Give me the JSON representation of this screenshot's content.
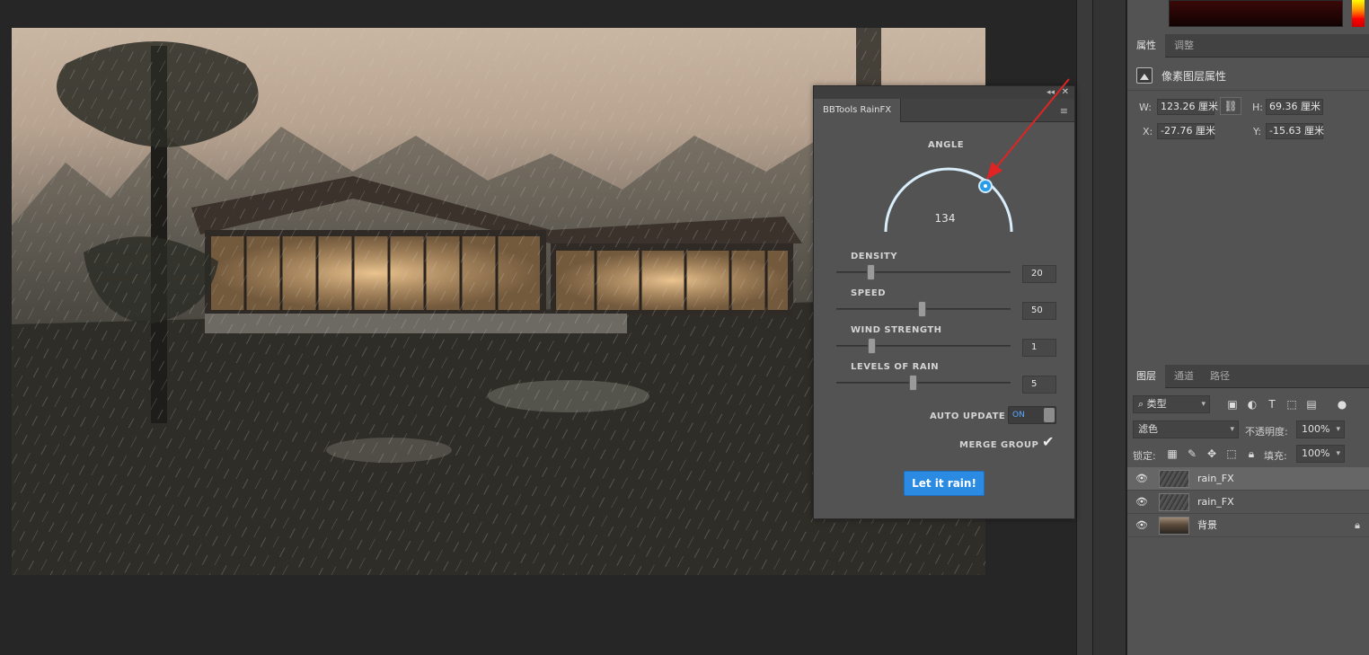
{
  "properties": {
    "tabs": [
      "属性",
      "调整"
    ],
    "title": "像素图层属性",
    "w_label": "W:",
    "w_value": "123.26 厘米",
    "h_label": "H:",
    "h_value": "69.36 厘米",
    "x_label": "X:",
    "x_value": "-27.76 厘米",
    "y_label": "Y:",
    "y_value": "-15.63 厘米"
  },
  "layers_panel": {
    "tabs": [
      "图层",
      "通道",
      "路径"
    ],
    "filter_kind": "类型",
    "blend_mode": "滤色",
    "opacity_label": "不透明度:",
    "opacity_value": "100%",
    "lock_label": "锁定:",
    "fill_label": "填充:",
    "fill_value": "100%",
    "layers": [
      {
        "name": "rain_FX",
        "selected": true
      },
      {
        "name": "rain_FX",
        "selected": false
      },
      {
        "name": "背景",
        "selected": false,
        "locked": true
      }
    ]
  },
  "plugin": {
    "tab_title": "BBTools RainFX",
    "angle_label": "ANGLE",
    "angle_value": "134",
    "density_label": "DENSITY",
    "density_value": "20",
    "speed_label": "SPEED",
    "speed_value": "50",
    "wind_label": "WIND STRENGTH",
    "wind_value": "1",
    "levels_label": "LEVELS OF RAIN",
    "levels_value": "5",
    "auto_update_label": "AUTO UPDATE",
    "auto_update_state": "ON",
    "merge_group_label": "MERGE GROUP",
    "button_label": "Let it rain!",
    "accent_color": "#2b8be3"
  }
}
